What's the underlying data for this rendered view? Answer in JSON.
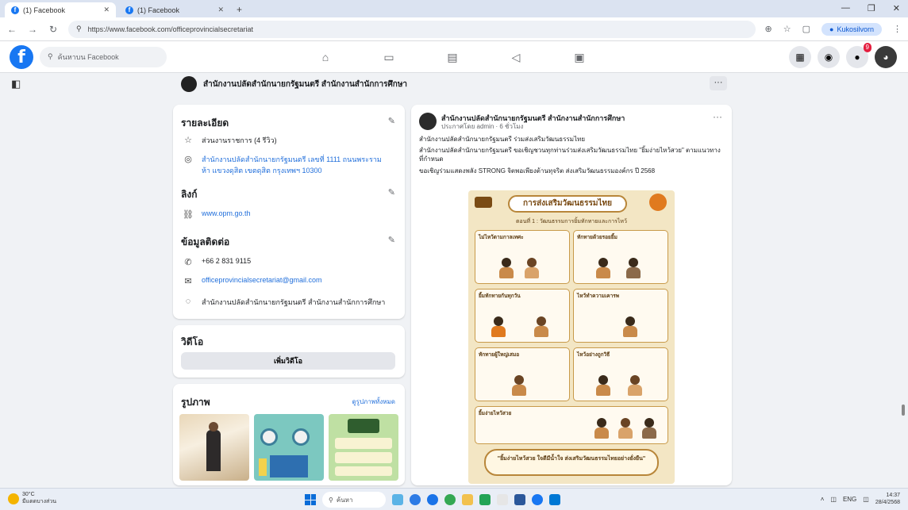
{
  "browser": {
    "tabs": [
      {
        "title": "(1) Facebook",
        "active": true
      },
      {
        "title": "(1) Facebook",
        "active": false
      }
    ],
    "url": "https://www.facebook.com/officeprovincialsecretariat",
    "profile_label": "Kukosilvorn"
  },
  "facebook": {
    "search_placeholder": "ค้นหาบน Facebook",
    "notification_count": "9",
    "page_name": "สำนักงานปลัดสำนักนายกรัฐมนตรี สำนักงานสำนักการศึกษา"
  },
  "about": {
    "title": "รายละเอียด",
    "category": "ส่วนงานราชการ (4 รีวิว)",
    "address": "สำนักงานปลัดสำนักนายกรัฐมนตรี เลขที่ 1111 ถนนพระรามห้า แขวงดุสิต เขตดุสิต กรุงเทพฯ 10300",
    "links_title": "ลิงก์",
    "website": "www.opm.go.th",
    "contact_title": "ข้อมูลติดต่อ",
    "phone": "+66 2 831 9115",
    "email": "officeprovincialsecretariat@gmail.com",
    "messenger": "สำนักงานปลัดสำนักนายกรัฐมนตรี สำนักงานสำนักการศึกษา"
  },
  "reels": {
    "title": "วิดีโอ",
    "button": "เพิ่มวิดีโอ"
  },
  "photos": {
    "title": "รูปภาพ",
    "see_all": "ดูรูปภาพทั้งหมด"
  },
  "post": {
    "author": "สำนักงานปลัดสำนักนายกรัฐมนตรี สำนักงานสำนักการศึกษา",
    "meta": "ประกาศโดย admin · 6 ชั่วโมง",
    "line1": "สำนักงานปลัดสำนักนายกรัฐมนตรี ร่วมส่งเสริมวัฒนธรรมไทย",
    "line2": "สำนักงานปลัดสำนักนายกรัฐมนตรี ขอเชิญชวนทุกท่านร่วมส่งเสริมวัฒนธรรมไทย \"ยิ้มง่ายไหว้สวย\" ตามแนวทางที่กำหนด",
    "line3": "ขอเชิญร่วมแสดงพลัง STRONG จิตพอเพียงต้านทุจริต ส่งเสริมวัฒนธรรมองค์กร ปี 2568"
  },
  "infographic": {
    "heading": "การส่งเสริมวัฒนธรรมไทย",
    "subtitle": "ตอนที่ 1 : วัฒนธรรมการยิ้มทักทายและการไหว้",
    "panels": [
      "ไม่ไหว้ตามกาลเทศะ",
      "ทักทายด้วยรอยยิ้ม",
      "ยิ้มทักทายกันทุกวัน",
      "ไหว้ทำความเคารพ",
      "ทักทายผู้ใหญ่เสมอ",
      "ไหว้อย่างถูกวิธี",
      "ยิ้มง่ายไหว้สวย"
    ],
    "footer": "\"ยิ้มง่ายไหว้สวย ใจดีมีน้ำใจ ส่งเสริมวัฒนธรรมไทยอย่างยั่งยืน\""
  },
  "taskbar": {
    "weather_temp": "30°C",
    "weather_desc": "มีแดดบางส่วน",
    "search_label": "ค้นหา",
    "lang": "ENG",
    "time": "14:37",
    "date": "28/4/2568"
  },
  "colors": {
    "fb_blue": "#1877f2",
    "link_blue": "#216fdb",
    "background": "#f0f2f5"
  },
  "icons": [
    "home-icon",
    "video-icon",
    "marketplace-icon",
    "groups-icon",
    "gaming-icon",
    "menu-grid-icon",
    "messenger-icon",
    "bell-icon",
    "star-icon",
    "location-icon",
    "link-icon",
    "phone-icon",
    "mail-icon",
    "chat-icon",
    "pencil-icon"
  ]
}
